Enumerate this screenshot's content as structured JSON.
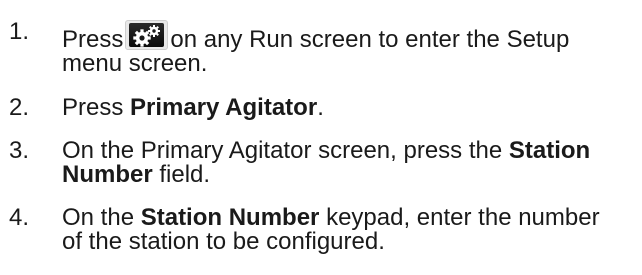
{
  "steps": [
    {
      "number": "1.",
      "line1_before": "Press",
      "line1_after": "on any Run screen to enter the Setup",
      "line2": "menu screen.",
      "icon": "settings-gears-icon"
    },
    {
      "number": "2.",
      "before": "Press ",
      "bold": "Primary Agitator",
      "after": "."
    },
    {
      "number": "3.",
      "line1_before": "On the Primary Agitator screen, press the ",
      "line1_bold": "Station",
      "line2_bold": "Number",
      "line2_after": " field."
    },
    {
      "number": "4.",
      "line1_before": "On the ",
      "line1_bold": "Station Number",
      "line1_after": " keypad, enter the number",
      "line2": "of the station to be configured."
    }
  ]
}
